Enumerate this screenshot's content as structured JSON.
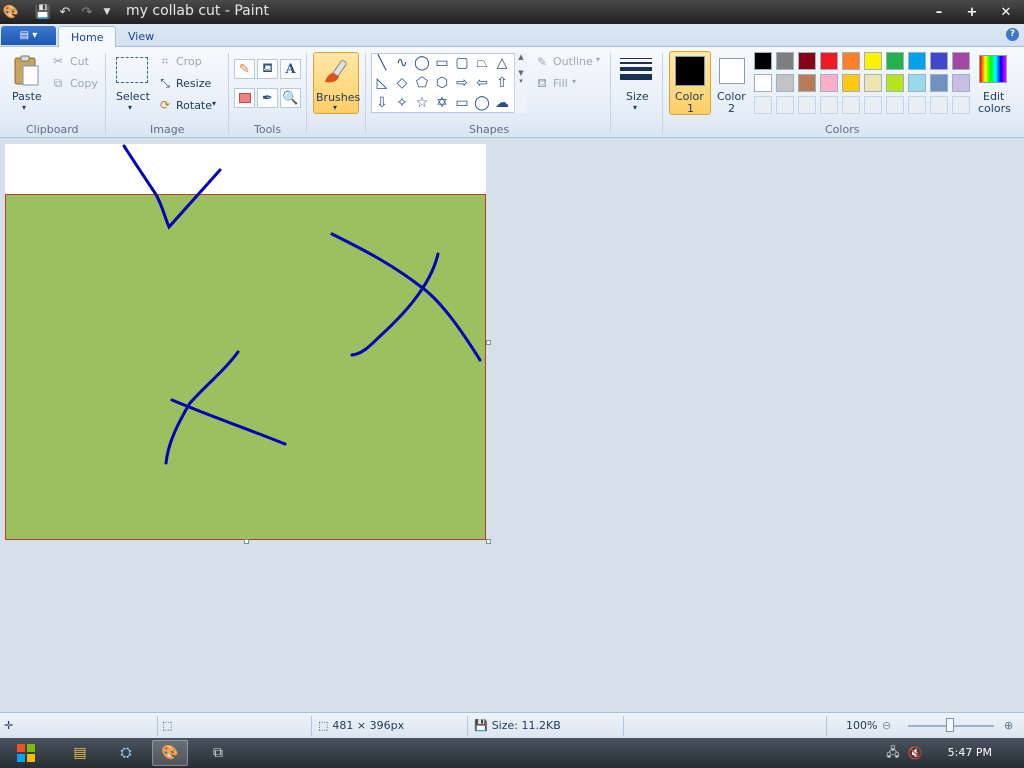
{
  "window": {
    "title": "my collab cut - Paint",
    "minimize_glyph": "–",
    "maximize_glyph": "+",
    "close_glyph": "✕"
  },
  "tabs": [
    {
      "label": "Home",
      "active": true
    },
    {
      "label": "View",
      "active": false
    }
  ],
  "clipboard": {
    "paste_label": "Paste",
    "cut_label": "Cut",
    "copy_label": "Copy",
    "group_label": "Clipboard"
  },
  "image": {
    "select_label": "Select",
    "crop_label": "Crop",
    "resize_label": "Resize",
    "rotate_label": "Rotate",
    "group_label": "Image"
  },
  "tools": {
    "group_label": "Tools",
    "items": [
      "pencil-icon",
      "fill-icon",
      "text-icon",
      "eraser-icon",
      "color-picker-icon",
      "magnifier-icon"
    ]
  },
  "brushes": {
    "label": "Brushes"
  },
  "shapes": {
    "group_label": "Shapes",
    "outline_label": "Outline",
    "fill_label": "Fill",
    "items": [
      "╲",
      "∿",
      "◯",
      "▭",
      "▢",
      "⏢",
      "△",
      "◺",
      "◇",
      "⬠",
      "⬡",
      "⇨",
      "⇦",
      "⇧",
      "⇩",
      "✧",
      "☆",
      "✡",
      "▭",
      "◯",
      "☁"
    ]
  },
  "size": {
    "label": "Size"
  },
  "colors": {
    "group_label": "Colors",
    "color1_label": "Color",
    "color1_num": "1",
    "color2_label": "Color",
    "color2_num": "2",
    "color1": "#000000",
    "color2": "#ffffff",
    "edit_label_1": "Edit",
    "edit_label_2": "colors",
    "palette_row1": [
      "#000000",
      "#7f7f7f",
      "#880015",
      "#ed1c24",
      "#ff7f27",
      "#fff200",
      "#22b14c",
      "#00a2e8",
      "#3f48cc",
      "#a349a4"
    ],
    "palette_row2": [
      "#ffffff",
      "#c3c3c3",
      "#b97a57",
      "#ffaec9",
      "#ffc90e",
      "#efe4b0",
      "#b5e61d",
      "#99d9ea",
      "#7092be",
      "#c8bfe7"
    ]
  },
  "canvas": {
    "background": "#ffffff",
    "selection_fill": "#9bc060",
    "stroke_color": "#0000b5"
  },
  "status": {
    "dimensions": "481 × 396px",
    "size": "Size: 11.2KB",
    "zoom": "100%"
  },
  "taskbar": {
    "clock": "5:47 PM"
  }
}
